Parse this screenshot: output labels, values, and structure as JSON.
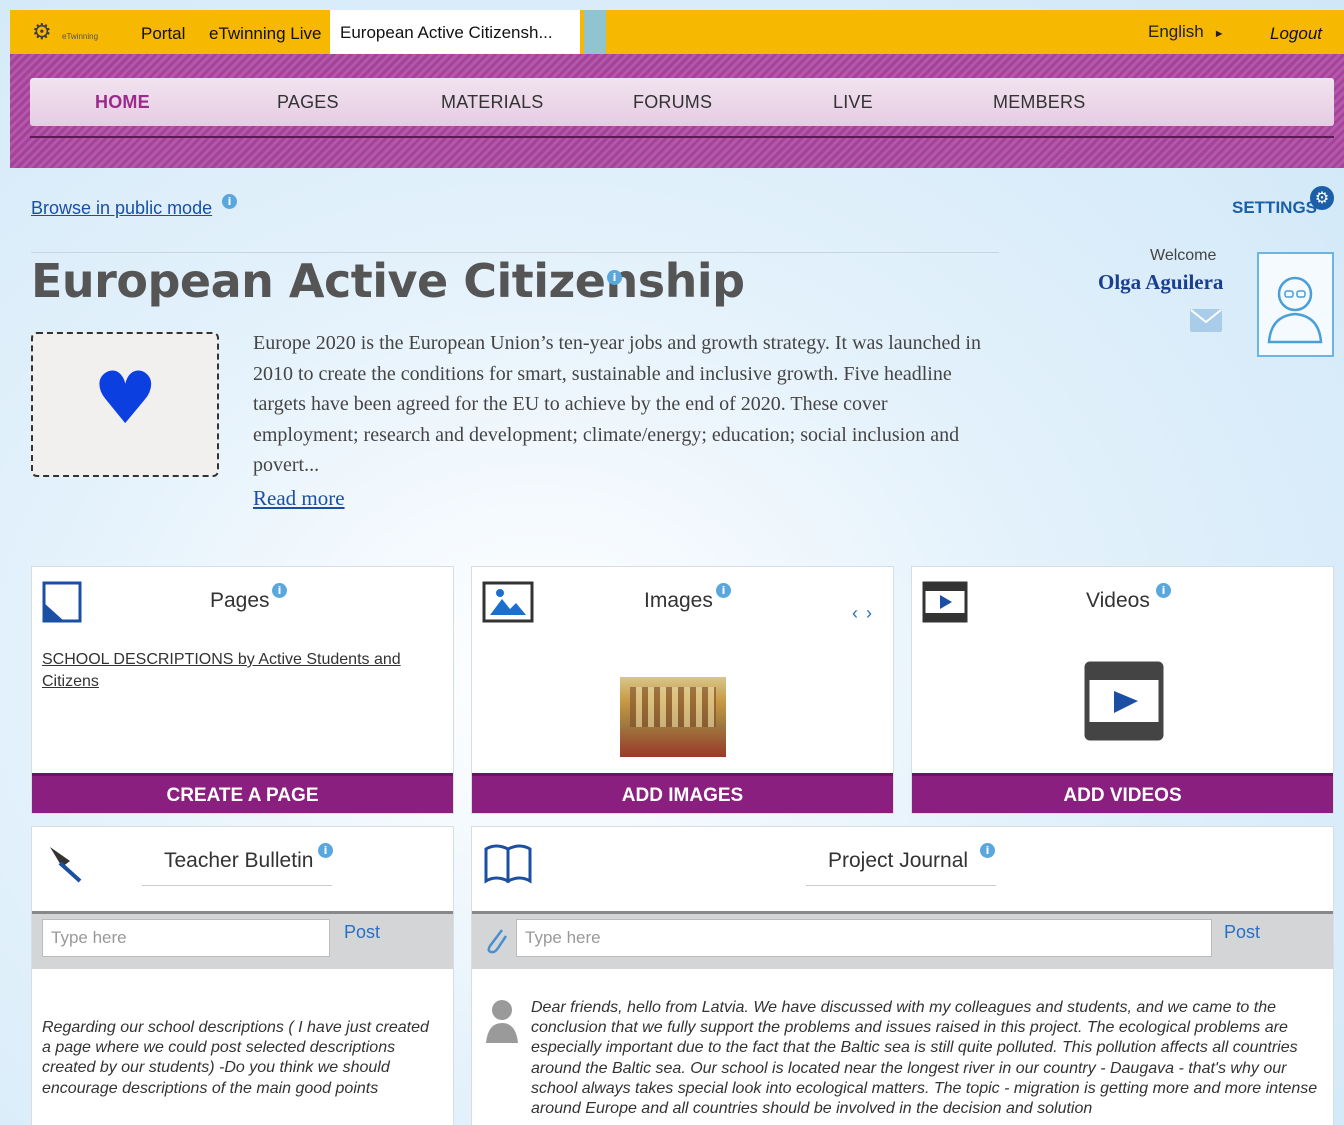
{
  "topbar": {
    "logo_text": "eTwinning",
    "portal": "Portal",
    "live": "eTwinning Live",
    "active_tab": "European Active Citizensh...",
    "language": "English",
    "language_arrow": "►",
    "logout": "Logout"
  },
  "nav": {
    "items": [
      "HOME",
      "PAGES",
      "MATERIALS",
      "FORUMS",
      "LIVE",
      "MEMBERS"
    ]
  },
  "browse": {
    "label": "Browse in public mode"
  },
  "settings": {
    "label": "SETTINGS"
  },
  "project": {
    "title": "European Active Citizenship",
    "description": "Europe 2020 is the European Union’s ten-year jobs and growth strategy. It was launched in 2010 to create the conditions for smart, sustainable and inclusive growth. Five headline targets have been agreed for the EU to achieve by the end of 2020. These cover employment; research and development; climate/energy; education; social inclusion and povert...",
    "read_more": "Read more"
  },
  "user": {
    "welcome": "Welcome",
    "name": "Olga Aguilera"
  },
  "cards": {
    "pages": {
      "title": "Pages",
      "link": "SCHOOL DESCRIPTIONS by Active Students and Citizens",
      "button": "CREATE A PAGE"
    },
    "images": {
      "title": "Images",
      "prev": "‹",
      "next": "›",
      "button": "ADD IMAGES"
    },
    "videos": {
      "title": "Videos",
      "button": "ADD VIDEOS"
    },
    "bulletin": {
      "title": "Teacher Bulletin",
      "placeholder": "Type here",
      "post": "Post",
      "message": "Regarding our school descriptions ( I have just created a page where we could post selected descriptions created by our students) -Do you think we should encourage descriptions of the main good points"
    },
    "journal": {
      "title": "Project Journal",
      "placeholder": "Type here",
      "post": "Post",
      "message": "Dear friends, hello from Latvia. We have discussed with my colleagues and students, and we came to the conclusion that we fully support the problems and issues raised in this project. The ecological problems are especially important due to the fact that the Baltic sea is still quite polluted. This pollution affects all countries around the Baltic sea. Our school is located near the longest river in our country - Daugava - that's why our school always takes special look into ecological matters. The topic - migration is getting more and more intense around Europe and all countries should be involved in the decision and solution"
    }
  },
  "colors": {
    "topbar": "#f6b800",
    "band": "#a6419c",
    "button": "#8a1f7f",
    "link": "#1a4fa3",
    "heart": "#0b3fe0"
  }
}
